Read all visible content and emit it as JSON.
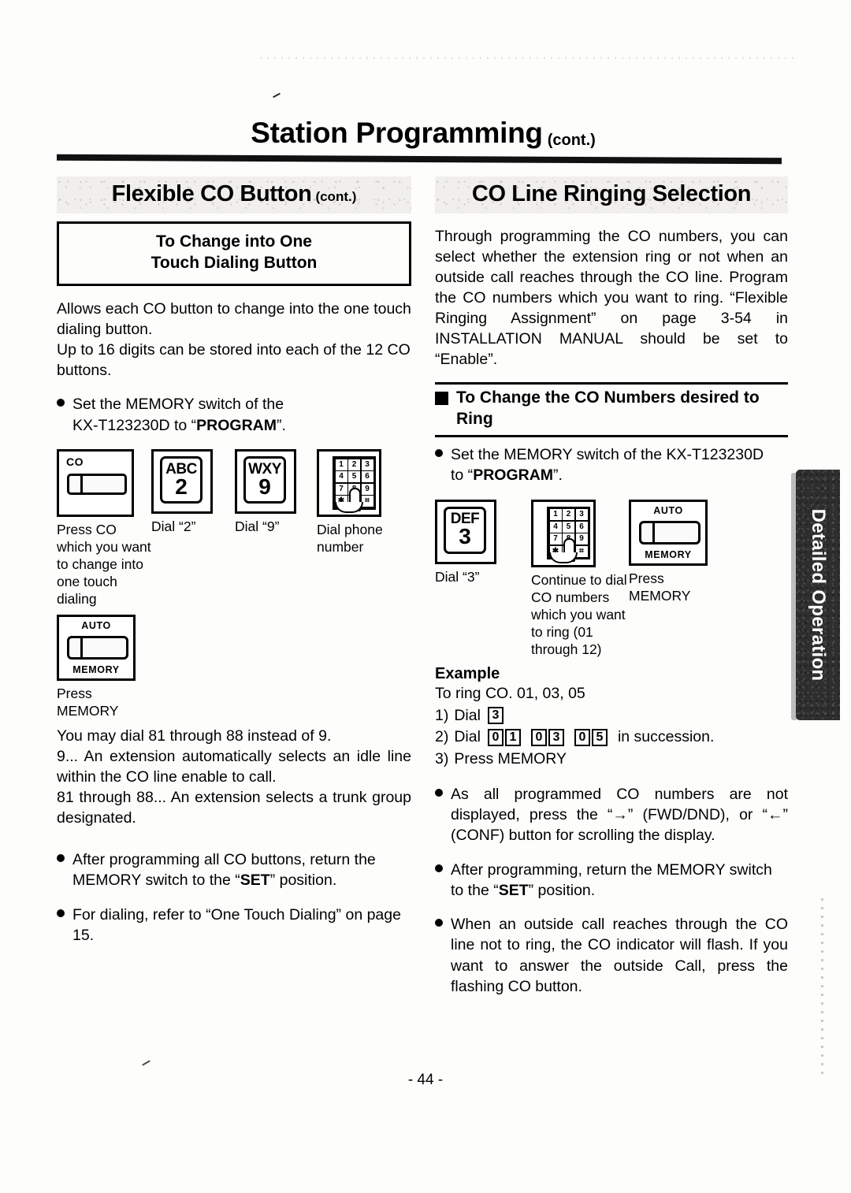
{
  "page": {
    "title_main": "Station Programming",
    "title_cont": "(cont.)",
    "page_number": "- 44 -",
    "side_tab_label": "Detailed Operation"
  },
  "left": {
    "section_title": "Flexible CO Button",
    "section_title_cont": "(cont.)",
    "box_title_line1": "To Change into One",
    "box_title_line2": "Touch Dialing Button",
    "intro_p1": "Allows each CO button to change into the one touch dialing button.",
    "intro_p2": "Up to 16 digits can be stored into each of the 12 CO buttons.",
    "bullet_memory_1": "Set the MEMORY switch of the",
    "bullet_memory_2_pre": "KX-T123230D to “",
    "bullet_memory_2_bold": "PROGRAM",
    "bullet_memory_2_post": "”.",
    "steps": [
      {
        "icon": "co-button-icon",
        "icon_label": "CO",
        "caption": "Press CO which you want to change into one touch dialing"
      },
      {
        "icon": "keypad-key-icon",
        "key_letters": "ABC",
        "key_digit": "2",
        "caption": "Dial “2”"
      },
      {
        "icon": "keypad-key-icon",
        "key_letters": "WXY",
        "key_digit": "9",
        "caption": "Dial “9”"
      },
      {
        "icon": "dial-pad-finger-icon",
        "caption": "Dial phone number"
      }
    ],
    "memory_step": {
      "icon": "auto-memory-switch-icon",
      "top_label": "AUTO",
      "bottom_label": "MEMORY",
      "caption": "Press MEMORY"
    },
    "note_line1": "You may dial 81 through 88 instead of 9.",
    "note_line2": "9... An extension automatically selects an idle line within the CO line enable to call.",
    "note_line3": "81 through 88... An extension selects a trunk group designated.",
    "bullet_after_pre": "After programming all CO buttons, return the MEMORY switch to the “",
    "bullet_after_bold": "SET",
    "bullet_after_post": "” position.",
    "bullet_dialing": "For dialing, refer to “One Touch Dialing” on page 15."
  },
  "right": {
    "section_title": "CO Line Ringing Selection",
    "intro": "Through programming the CO numbers, you can select whether the extension ring or not when an outside call reaches through the CO line. Program the CO numbers which you want to ring. “Flexible Ringing Assignment” on page 3-54 in INSTALLATION MANUAL should be set to “Enable”.",
    "sub_head_line1": "To Change the CO Numbers desired to",
    "sub_head_line2": "Ring",
    "bullet_memory_1": "Set the MEMORY switch of the KX-T123230D",
    "bullet_memory_2_pre": "to “",
    "bullet_memory_2_bold": "PROGRAM",
    "bullet_memory_2_post": "”.",
    "steps": [
      {
        "icon": "keypad-key-icon",
        "key_letters": "DEF",
        "key_digit": "3",
        "caption": "Dial “3”"
      },
      {
        "icon": "dial-pad-finger-icon",
        "caption": "Continue to dial CO numbers which you want to ring (01 through 12)"
      },
      {
        "icon": "auto-memory-switch-icon",
        "top_label": "AUTO",
        "bottom_label": "MEMORY",
        "caption": "Press MEMORY"
      }
    ],
    "example": {
      "title": "Example",
      "subtitle": "To ring CO. 01, 03, 05",
      "step1_label": "1)",
      "step1_text": "Dial",
      "step1_digit": "3",
      "step2_label": "2)",
      "step2_text": "Dial",
      "step2_pairs": [
        [
          "0",
          "1"
        ],
        [
          "0",
          "3"
        ],
        [
          "0",
          "5"
        ]
      ],
      "step2_tail": "in succession.",
      "step3_label": "3)",
      "step3_text": "Press MEMORY"
    },
    "bullet_scroll": "As all programmed CO numbers are not displayed, press the “→” (FWD/DND), or “←” (CONF) button for scrolling the display.",
    "bullet_after_pre": "After programming, return the MEMORY switch to the “",
    "bullet_after_bold": "SET",
    "bullet_after_post": "” position.",
    "bullet_flash": "When an outside call reaches through the CO line not to ring, the CO indicator will flash. If you want to answer the outside Call, press the flashing CO button."
  },
  "keypad": {
    "keys": [
      "1",
      "2",
      "3",
      "4",
      "5",
      "6",
      "7",
      "8",
      "9",
      "✱",
      "0",
      "⌗"
    ]
  },
  "colors": {
    "ink": "#000000",
    "paper": "#fdfdfc",
    "header_band": "#f0efed",
    "side_tab": "#2e2e2e"
  }
}
